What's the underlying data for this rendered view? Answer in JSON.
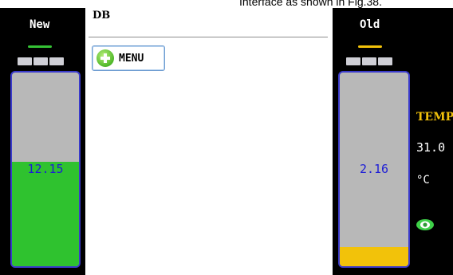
{
  "caption": "Interface as shown in Fig.38.",
  "colors": {
    "screen_bg": "#000000",
    "new_indicator": "#35c235",
    "new_fill": "#2fc22f",
    "old_indicator": "#f2c20a",
    "old_fill": "#f2c20a",
    "bar_outline": "#3a3acb",
    "value_text": "#1c1cd6",
    "temp_label": "#f2c20a"
  },
  "left_panel": {
    "label": "New",
    "value": "12.15",
    "fill_fraction": 0.54,
    "cap_segments": 3
  },
  "center": {
    "title": "DB",
    "menu_button": {
      "icon": "plus-icon",
      "label": "MENU"
    }
  },
  "right_panel": {
    "label": "Old",
    "value": "2.16",
    "fill_fraction": 0.1,
    "cap_segments": 3
  },
  "temperature": {
    "label": "TEMP",
    "value": "31.0",
    "unit": "°C",
    "icon": "eye-icon"
  }
}
